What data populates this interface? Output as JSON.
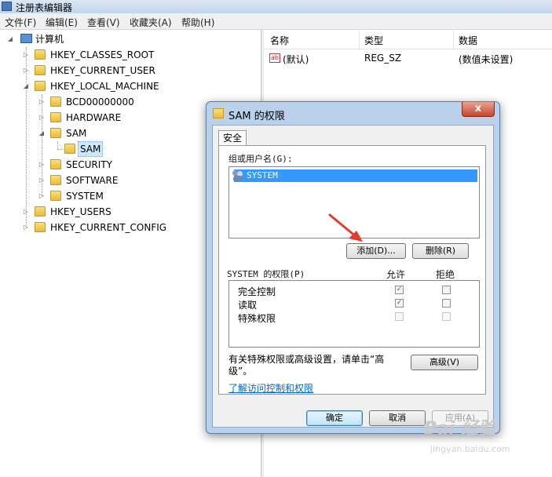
{
  "window": {
    "title": "注册表编辑器",
    "icon": "regedit-icon"
  },
  "menu": [
    "文件(F)",
    "编辑(E)",
    "查看(V)",
    "收藏夹(A)",
    "帮助(H)"
  ],
  "tree": {
    "root": "计算机",
    "items": [
      {
        "label": "HKEY_CLASSES_ROOT"
      },
      {
        "label": "HKEY_CURRENT_USER"
      },
      {
        "label": "HKEY_LOCAL_MACHINE",
        "expanded": true
      },
      {
        "label": "BCD00000000"
      },
      {
        "label": "HARDWARE"
      },
      {
        "label": "SAM",
        "expanded": true
      },
      {
        "label": "SAM",
        "selected": true
      },
      {
        "label": "SECURITY"
      },
      {
        "label": "SOFTWARE"
      },
      {
        "label": "SYSTEM"
      },
      {
        "label": "HKEY_USERS"
      },
      {
        "label": "HKEY_CURRENT_CONFIG"
      }
    ]
  },
  "list": {
    "columns": [
      "名称",
      "类型",
      "数据"
    ],
    "rows": [
      {
        "name": "(默认)",
        "type": "REG_SZ",
        "data": "(数值未设置)"
      }
    ]
  },
  "dialog": {
    "title": "SAM 的权限",
    "close_label": "x",
    "tab": "安全",
    "group_label": "组或用户名(G):",
    "users": [
      "SYSTEM"
    ],
    "add_button": "添加(D)...",
    "remove_button": "删除(R)",
    "perm_label": "SYSTEM 的权限(P)",
    "allow_label": "允许",
    "deny_label": "拒绝",
    "permissions": [
      {
        "name": "完全控制",
        "allow": true,
        "deny": false
      },
      {
        "name": "读取",
        "allow": true,
        "deny": false
      },
      {
        "name": "特殊权限",
        "allow": false,
        "deny": false
      }
    ],
    "advanced_text": "有关特殊权限或高级设置，请单击“高级”。",
    "advanced_button": "高级(V)",
    "learn_link": "了解访问控制和权限",
    "ok_button": "确定",
    "cancel_button": "取消",
    "apply_button": "应用(A)"
  },
  "colors": {
    "selection": "#3399ff",
    "link": "#0066cc",
    "dialog_frame": "#b9d1ea",
    "annotation_arrow": "#e53b2c"
  },
  "watermark": {
    "main": "Bai 经验",
    "sub": "jingyan.baidu.com"
  }
}
